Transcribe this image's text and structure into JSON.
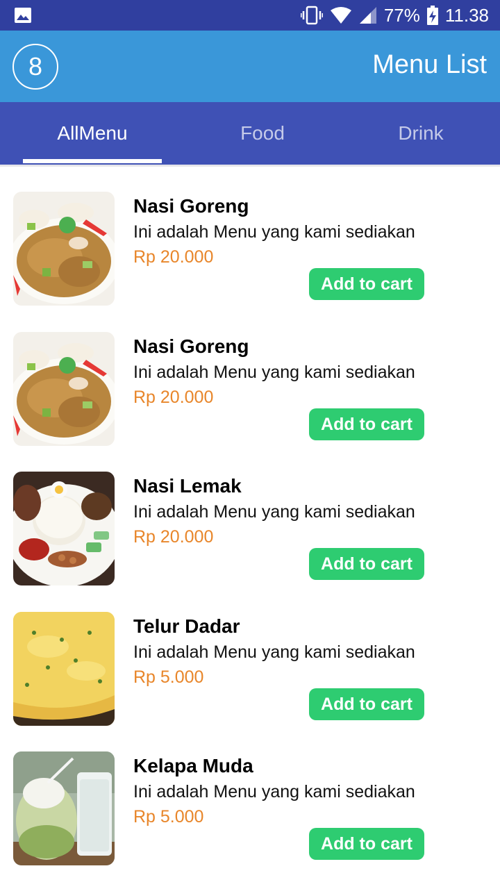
{
  "status_bar": {
    "battery": "77%",
    "time": "11.38",
    "icons": [
      "gallery-icon",
      "vibrate-icon",
      "wifi-icon",
      "signal-icon",
      "battery-charging-icon"
    ]
  },
  "app_bar": {
    "badge_count": "8",
    "title": "Menu List"
  },
  "tabs": [
    {
      "label": "AllMenu",
      "active": true
    },
    {
      "label": "Food",
      "active": false
    },
    {
      "label": "Drink",
      "active": false
    }
  ],
  "colors": {
    "status_bar": "#303f9f",
    "app_bar": "#3a97d9",
    "tab_bar": "#3f51b5",
    "price": "#e8862a",
    "button": "#2ecc71"
  },
  "menu_items": [
    {
      "name": "Nasi Goreng",
      "description": "Ini adalah Menu yang kami sediakan",
      "price": "Rp 20.000",
      "button": "Add to cart",
      "image": "fried-rice-photo"
    },
    {
      "name": "Nasi Goreng",
      "description": "Ini adalah Menu yang kami sediakan",
      "price": "Rp 20.000",
      "button": "Add to cart",
      "image": "fried-rice-photo"
    },
    {
      "name": "Nasi Lemak",
      "description": "Ini adalah Menu yang kami sediakan",
      "price": "Rp 20.000",
      "button": "Add to cart",
      "image": "nasi-lemak-photo"
    },
    {
      "name": "Telur Dadar",
      "description": "Ini adalah Menu yang kami sediakan",
      "price": "Rp 5.000",
      "button": "Add to cart",
      "image": "omelette-photo"
    },
    {
      "name": "Kelapa Muda",
      "description": "Ini adalah Menu yang kami sediakan",
      "price": "Rp 5.000",
      "button": "Add to cart",
      "image": "young-coconut-photo"
    }
  ]
}
